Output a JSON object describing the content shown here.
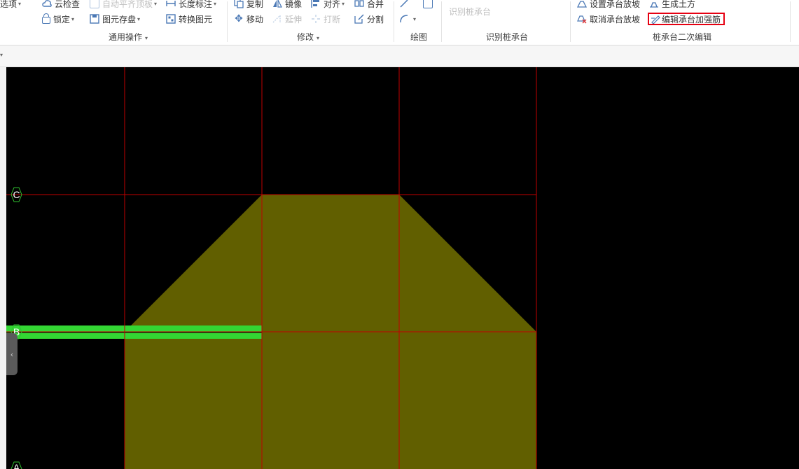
{
  "ribbon": {
    "general": {
      "options_label": "选项",
      "cloud_check": "云检查",
      "auto_align_slab": "自动平齐顶板",
      "length_dim": "长度标注",
      "lock": "锁定",
      "save_elements": "图元存盘",
      "convert_elements": "转换图元",
      "group_label": "通用操作"
    },
    "modify": {
      "copy": "复制",
      "mirror": "镜像",
      "align": "对齐",
      "merge": "合并",
      "move": "移动",
      "extend": "延伸",
      "break": "打断",
      "split": "分割",
      "group_label": "修改"
    },
    "draw": {
      "group_label": "绘图"
    },
    "identify": {
      "identify_cap": "识别桩承台",
      "group_label": "识别桩承台"
    },
    "cap_edit": {
      "set_slope": "设置承台放坡",
      "gen_earthwork": "生成土方",
      "cancel_slope": "取消承台放坡",
      "edit_rebar": "编辑承台加强筋",
      "group_label": "桩承台二次编辑"
    }
  },
  "canvas": {
    "axes": [
      "C",
      "B",
      "A"
    ],
    "colors": {
      "background": "#000000",
      "grid_line": "#c00000",
      "cap_fill": "#615f00",
      "beam": "#33d633",
      "axis_marker": "#2fbf2f",
      "highlight": "#e60012"
    }
  },
  "icons": [
    "cloud-check-icon",
    "lock-icon",
    "save-icon",
    "ruler-icon",
    "convert-icon",
    "copy-icon",
    "mirror-icon",
    "align-icon",
    "merge-icon",
    "move-icon",
    "extend-icon",
    "break-icon",
    "split-icon",
    "line-icon",
    "arc-icon",
    "rect-icon",
    "slope-icon",
    "earthwork-icon",
    "cancel-slope-icon",
    "edit-rebar-icon",
    "collapse-icon"
  ]
}
